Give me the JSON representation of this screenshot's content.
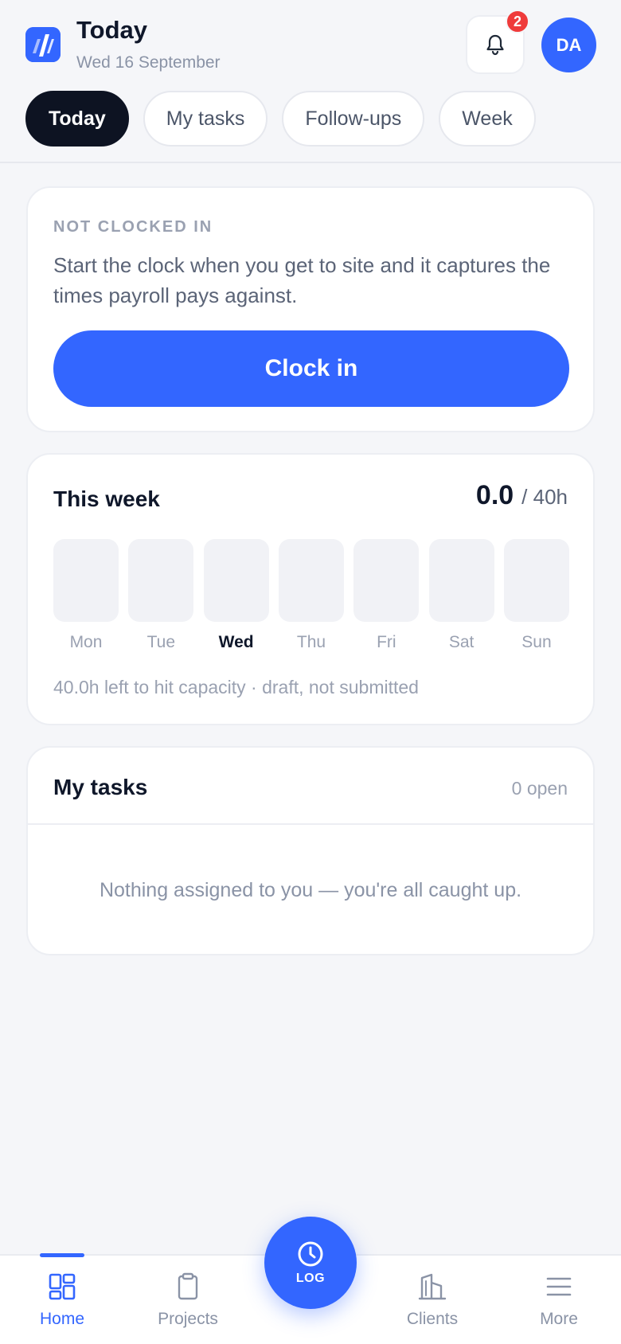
{
  "header": {
    "title": "Today",
    "date": "Wed 16 September",
    "notification_count": "2",
    "avatar_initials": "DA",
    "icons": {
      "logo": "app-logo",
      "bell": "bell-icon"
    }
  },
  "tabs": [
    {
      "label": "Today",
      "active": true
    },
    {
      "label": "My tasks",
      "active": false
    },
    {
      "label": "Follow-ups",
      "active": false
    },
    {
      "label": "Week",
      "active": false
    }
  ],
  "clock_card": {
    "status": "NOT CLOCKED IN",
    "description": "Start the clock when you get to site and it captures the times payroll pays against.",
    "button_label": "Clock in"
  },
  "week_card": {
    "title": "This week",
    "hours_logged": "0.0",
    "capacity": "/ 40h",
    "days": [
      {
        "label": "Mon",
        "hours": 0,
        "current": false
      },
      {
        "label": "Tue",
        "hours": 0,
        "current": false
      },
      {
        "label": "Wed",
        "hours": 0,
        "current": true
      },
      {
        "label": "Thu",
        "hours": 0,
        "current": false
      },
      {
        "label": "Fri",
        "hours": 0,
        "current": false
      },
      {
        "label": "Sat",
        "hours": 0,
        "current": false
      },
      {
        "label": "Sun",
        "hours": 0,
        "current": false
      }
    ],
    "footer": "40.0h left to hit capacity · draft, not submitted"
  },
  "tasks_card": {
    "title": "My tasks",
    "count": "0 open",
    "empty_message": "Nothing assigned to you — you're all caught up."
  },
  "bottom_nav": {
    "items": [
      {
        "label": "Home",
        "icon": "dashboard-icon",
        "active": true
      },
      {
        "label": "Projects",
        "icon": "clipboard-icon",
        "active": false
      },
      {
        "label": "Clients",
        "icon": "building-icon",
        "active": false
      },
      {
        "label": "More",
        "icon": "menu-icon",
        "active": false
      }
    ],
    "fab_label": "LOG",
    "fab_icon": "clock-icon"
  },
  "colors": {
    "accent": "#3366ff",
    "dark": "#0d1322",
    "badge": "#ef3b3b",
    "background": "#f5f6f9",
    "muted": "#9aa1b1"
  }
}
